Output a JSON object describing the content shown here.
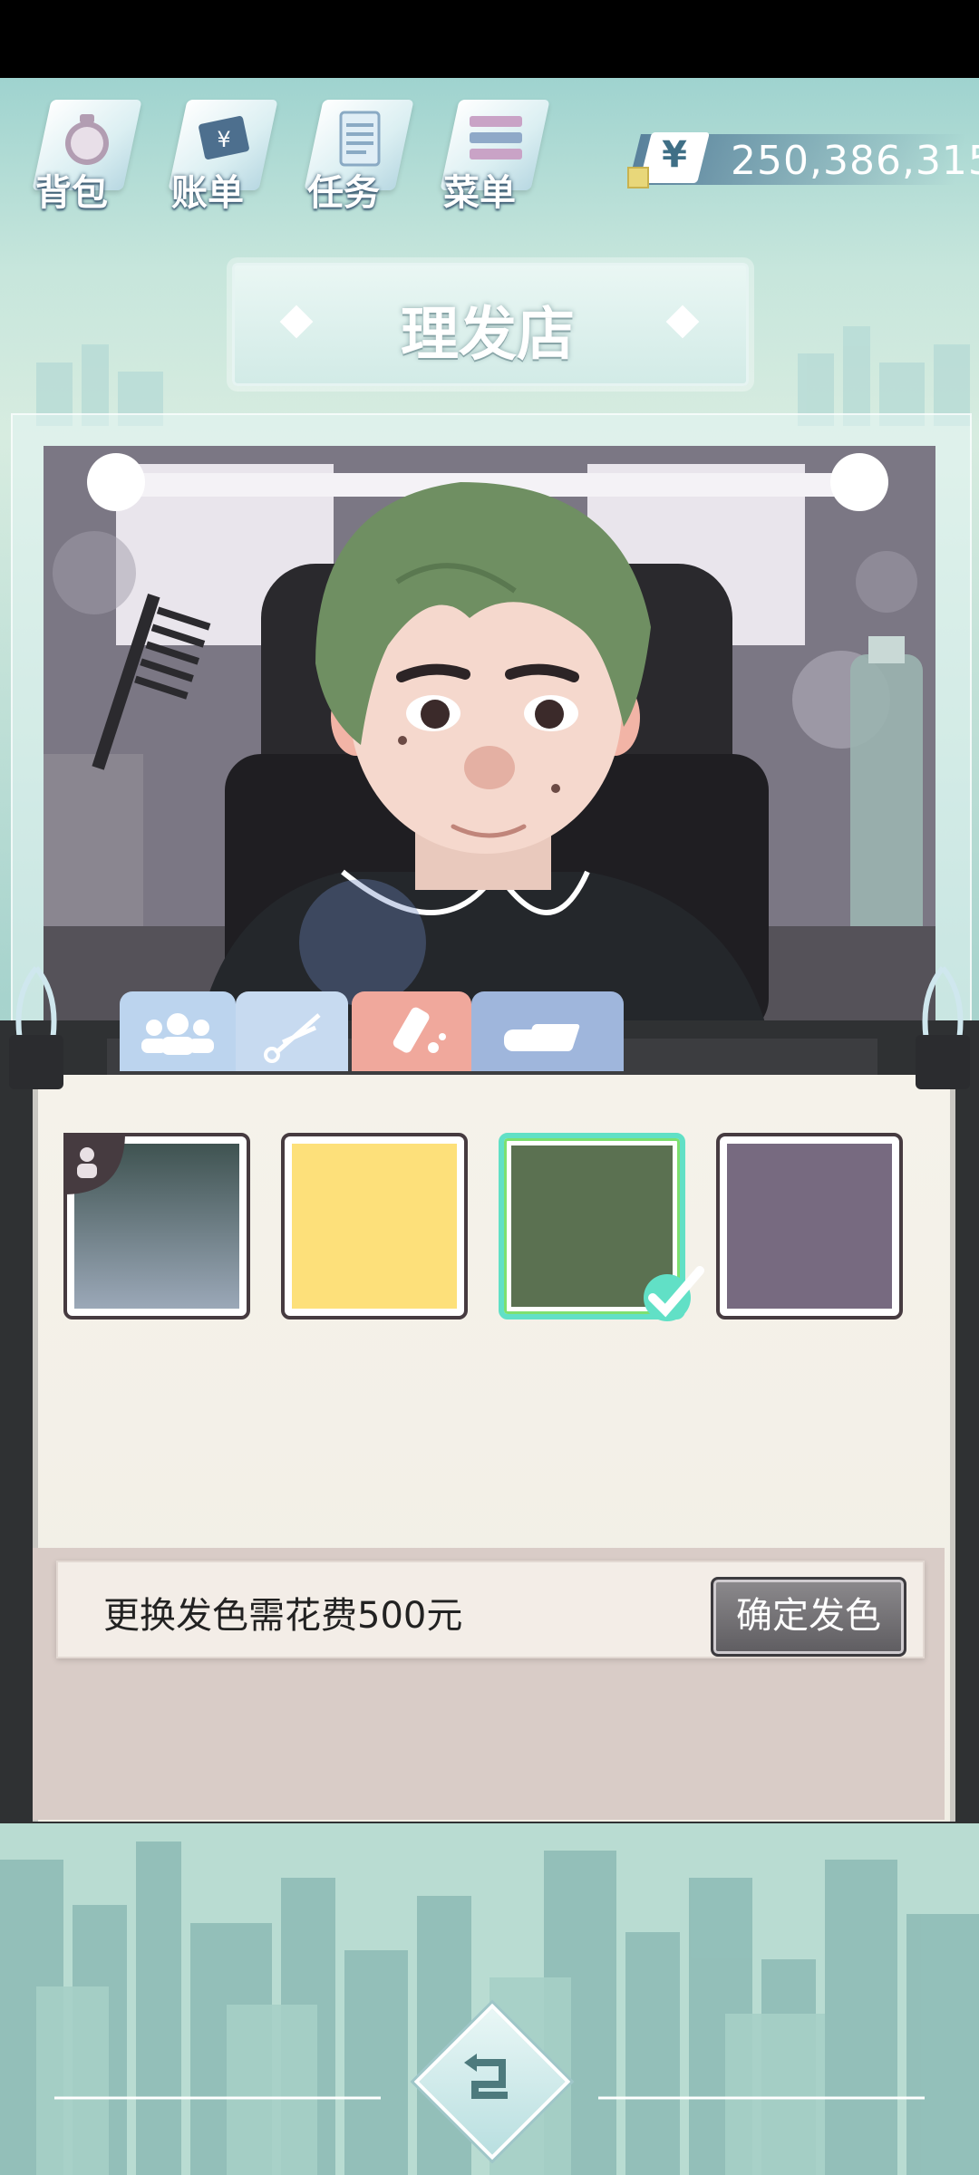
{
  "nav": {
    "items": [
      {
        "label": "背包",
        "icon": "backpack-icon"
      },
      {
        "label": "账单",
        "icon": "bill-icon"
      },
      {
        "label": "任务",
        "icon": "task-icon"
      },
      {
        "label": "菜单",
        "icon": "menu-icon"
      }
    ]
  },
  "currency": {
    "symbol": "¥",
    "amount": "250,386,315"
  },
  "title": "理发店",
  "tabs": [
    {
      "name": "people",
      "icon": "people-icon",
      "color": "#bcd4ee"
    },
    {
      "name": "scissors",
      "icon": "scissors-icon",
      "color": "#c7daf0"
    },
    {
      "name": "hair-dye",
      "icon": "hair-dye-icon",
      "color": "#f0a89c"
    },
    {
      "name": "eraser",
      "icon": "eraser-icon",
      "color": "#9fb6dc"
    }
  ],
  "swatches": [
    {
      "name": "original",
      "gradient": [
        "#3f5351",
        "#9ba8b8"
      ],
      "selected": false,
      "original_badge": true
    },
    {
      "name": "yellow",
      "color": "#fde07a",
      "selected": false
    },
    {
      "name": "green",
      "color": "#5b7151",
      "selected": true
    },
    {
      "name": "mauve",
      "color": "#776a80",
      "selected": false
    }
  ],
  "info": {
    "text": "更换发色需花费500元",
    "confirm_label": "确定发色"
  },
  "colors": {
    "accent": "#61e0c6",
    "selected_border": "#7de070",
    "hair": "#6f8f62"
  }
}
